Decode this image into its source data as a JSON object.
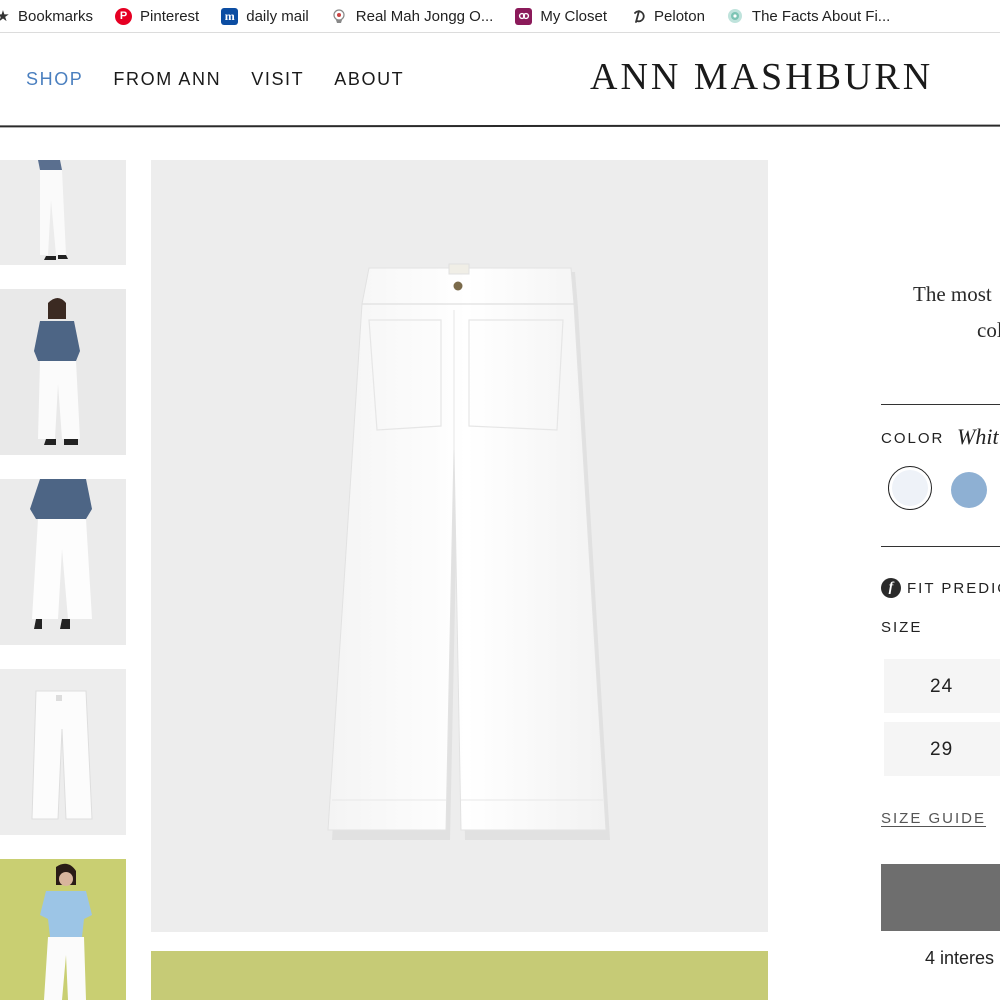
{
  "bookmarks": [
    {
      "label": "Bookmarks",
      "icon": "star-icon"
    },
    {
      "label": "Pinterest",
      "icon": "pinterest-icon"
    },
    {
      "label": "daily mail",
      "icon": "daily-mail-icon"
    },
    {
      "label": "Real Mah Jongg O...",
      "icon": "mahjong-icon"
    },
    {
      "label": "My Closet",
      "icon": "closet-icon"
    },
    {
      "label": "Peloton",
      "icon": "peloton-icon"
    },
    {
      "label": "The Facts About Fi...",
      "icon": "facts-icon"
    }
  ],
  "nav": {
    "items": [
      "SHOP",
      "FROM ANN",
      "VISIT",
      "ABOUT"
    ],
    "active": "SHOP",
    "active_color": "#4a7fbf"
  },
  "brand": {
    "logo": "ANN MASHBURN"
  },
  "product": {
    "description_line1": "The most",
    "description_line2": "col",
    "color_label": "COLOR",
    "color_value": "Whit",
    "swatches": [
      {
        "name": "White",
        "color": "#eef2f8",
        "selected": true
      },
      {
        "name": "Light Blue",
        "color": "#8eb0d3",
        "selected": false
      }
    ],
    "fit_icon": "fit-predictor-icon",
    "fit_label": "FIT PREDIC",
    "size_label": "SIZE",
    "sizes": [
      "24",
      "29"
    ],
    "size_guide": "SIZE GUIDE",
    "interest_text": "4 interes"
  },
  "colors": {
    "image_bg": "#ededed",
    "lime_bg": "#c9cf72",
    "add_button": "#6e6e6e"
  }
}
